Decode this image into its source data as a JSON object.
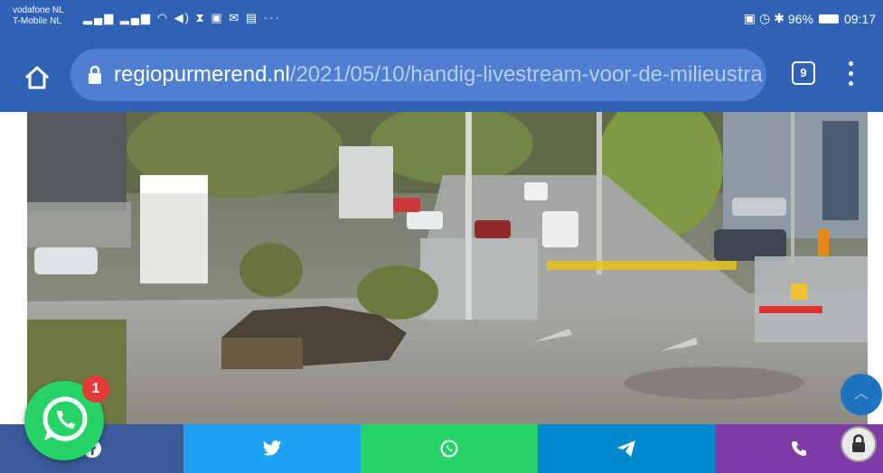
{
  "status_bar": {
    "carrier_1": "vodafone NL",
    "carrier_2": "T-Mobile NL",
    "battery": "96%",
    "time": "09:17"
  },
  "browser": {
    "url_domain": "regiopurmerend.nl",
    "url_path": "/2021/05/10/handig-livestream-voor-de-milieustra",
    "tab_count": "9"
  },
  "floating": {
    "whatsapp_badge": "1",
    "scroll_top_icon": "chevron-up-icon"
  },
  "share_bar": {
    "buttons": [
      {
        "name": "facebook",
        "icon": "facebook-icon",
        "color": "#3b5998"
      },
      {
        "name": "twitter",
        "icon": "twitter-icon",
        "color": "#1da1f2"
      },
      {
        "name": "whatsapp",
        "icon": "whatsapp-icon",
        "color": "#25d366"
      },
      {
        "name": "telegram",
        "icon": "telegram-icon",
        "color": "#0088cc"
      },
      {
        "name": "phone",
        "icon": "phone-icon",
        "color": "#7e3ba6"
      }
    ]
  },
  "colors": {
    "browser_bar": "#2f62b5",
    "url_pill": "#4f7fd1"
  }
}
